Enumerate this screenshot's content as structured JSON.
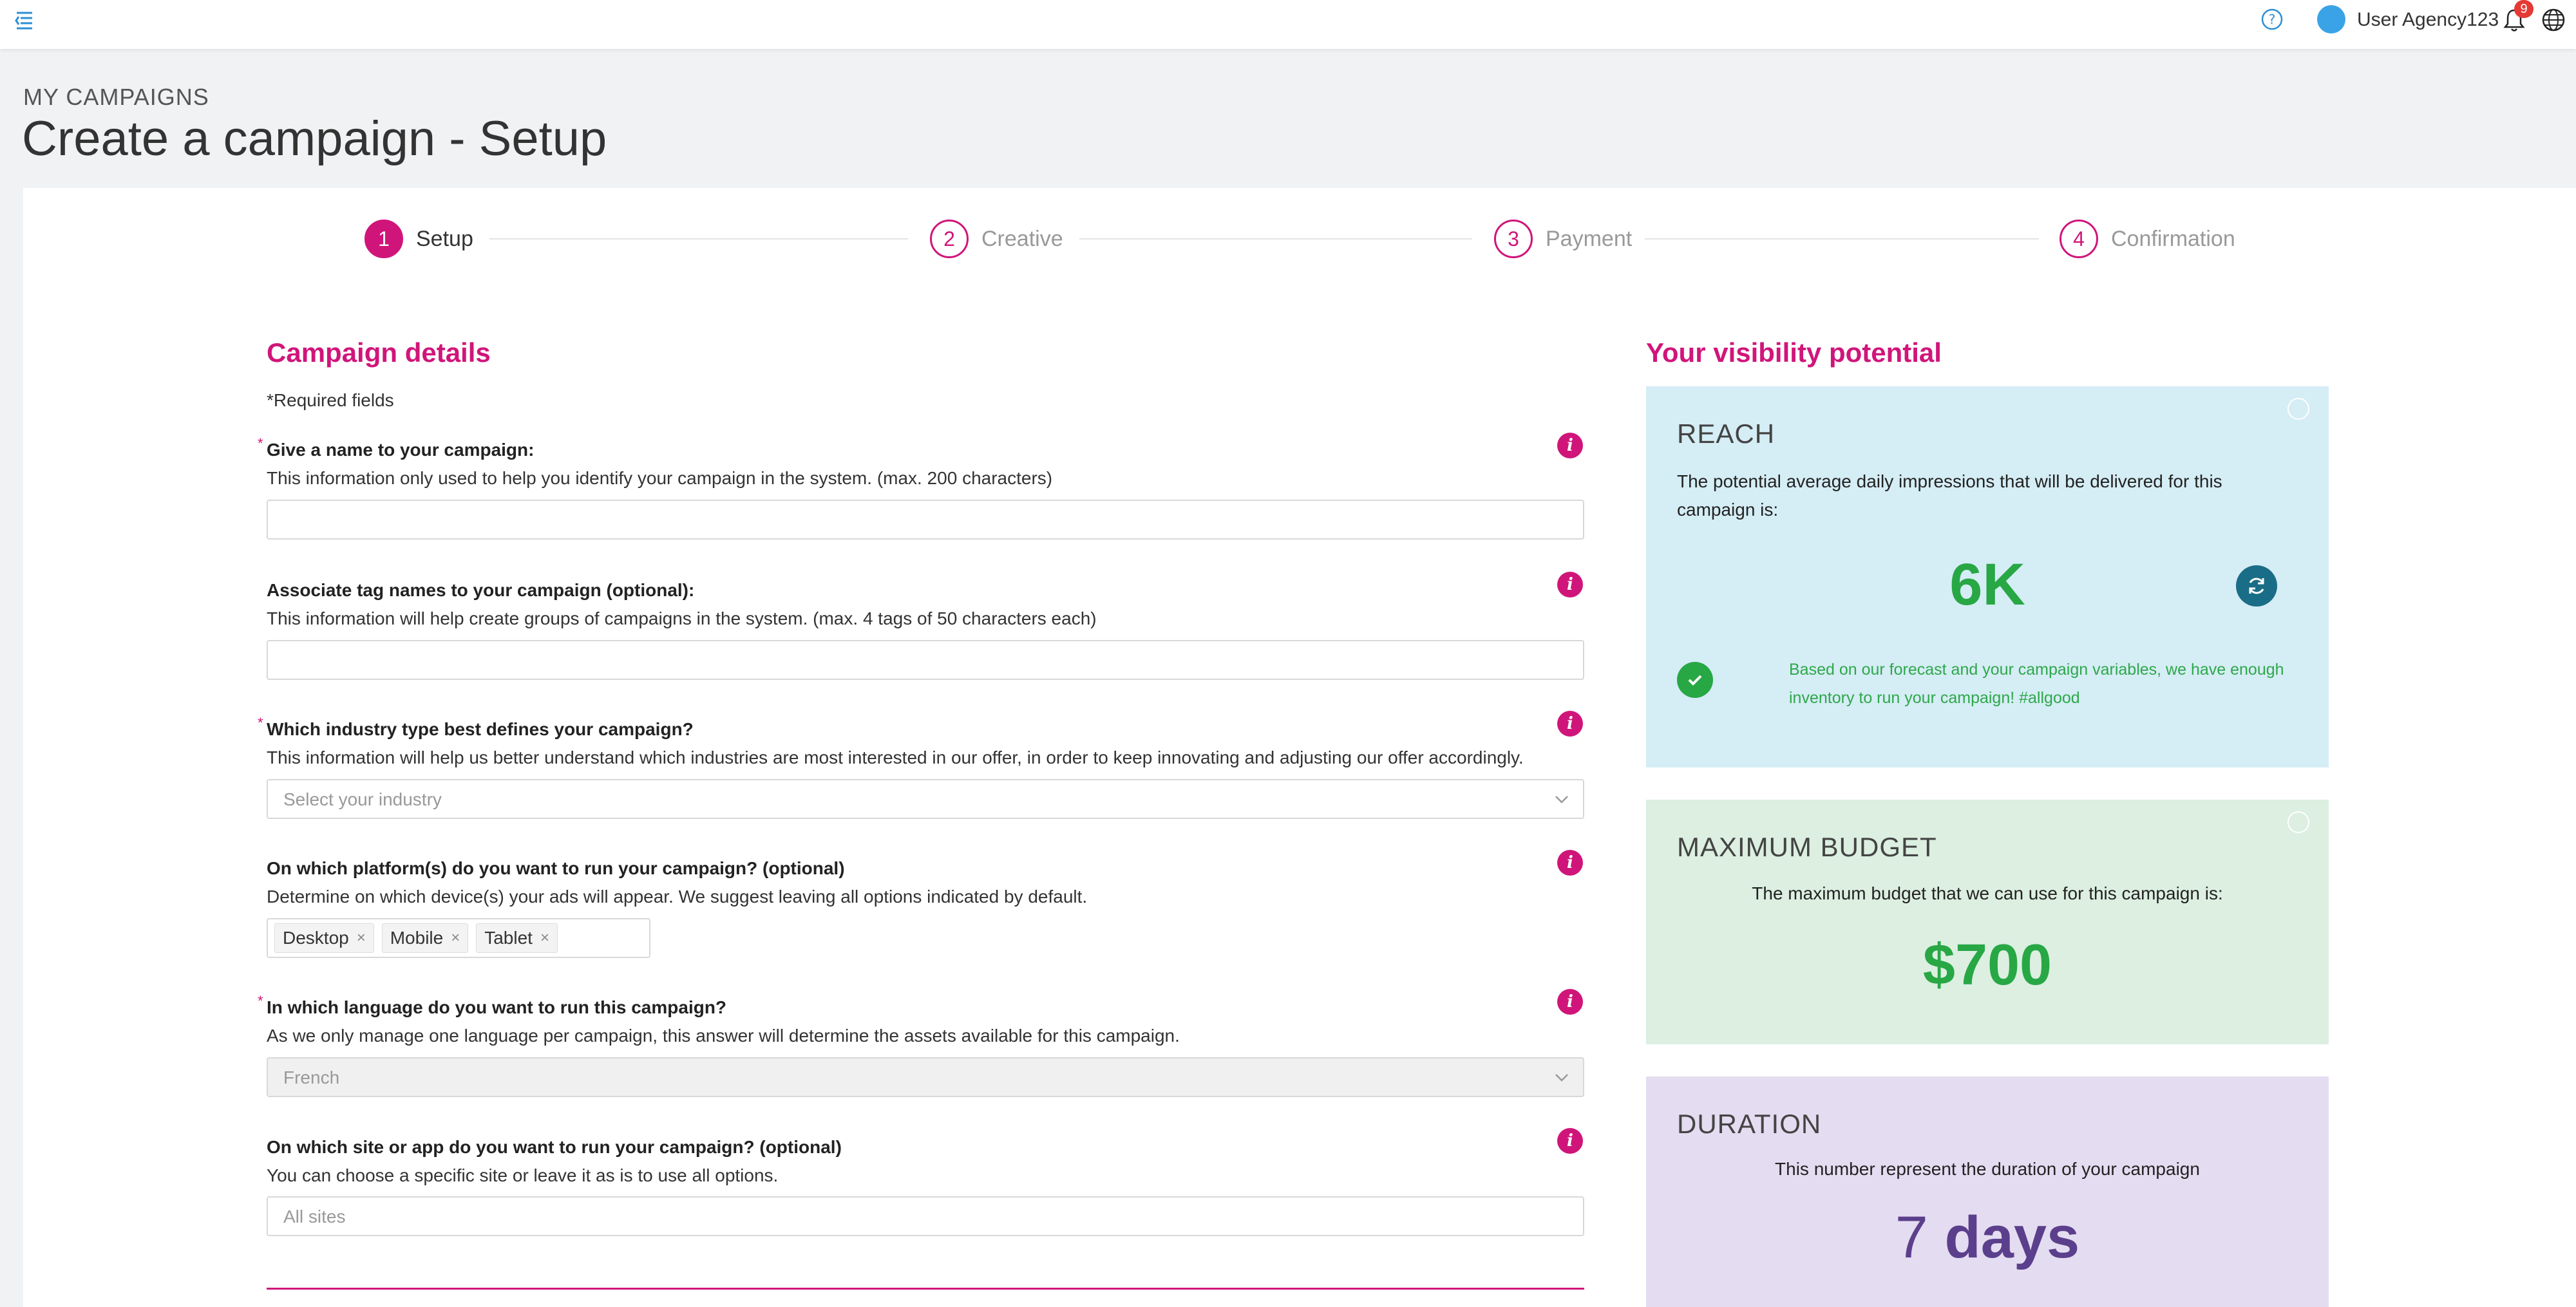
{
  "header": {
    "user_name": "User Agency123",
    "notification_count": "9"
  },
  "page": {
    "breadcrumb": "MY CAMPAIGNS",
    "title": "Create a campaign - Setup"
  },
  "steps": [
    {
      "number": "1",
      "label": "Setup",
      "active": true
    },
    {
      "number": "2",
      "label": "Creative",
      "active": false
    },
    {
      "number": "3",
      "label": "Payment",
      "active": false
    },
    {
      "number": "4",
      "label": "Confirmation",
      "active": false
    }
  ],
  "form": {
    "title": "Campaign details",
    "required_note": "*Required fields",
    "questions": [
      {
        "label": "Give a name to your campaign:",
        "desc": "This information only used to help you identify your campaign in the system. (max. 200 characters)",
        "required": true
      },
      {
        "label": "Associate tag names to your campaign (optional):",
        "desc": "This information will help create groups of campaigns in the system. (max. 4 tags of 50 characters each)",
        "required": false
      },
      {
        "label": "Which industry type best defines your campaign?",
        "desc": "This information will help us better understand which industries are most interested in our offer, in order to keep innovating and adjusting our offer accordingly.",
        "required": true,
        "placeholder": "Select your industry"
      },
      {
        "label": "On which platform(s) do you want to run your campaign? (optional)",
        "desc": "Determine on which device(s) your ads will appear. We suggest leaving all options indicated by default.",
        "required": false,
        "tags": [
          "Desktop",
          "Mobile",
          "Tablet"
        ]
      },
      {
        "label": "In which language do you want to run this campaign?",
        "desc": "As we only manage one language per campaign, this answer will determine the assets available for this campaign.",
        "required": true,
        "value": "French"
      },
      {
        "label": "On which site or app do you want to run your campaign? (optional)",
        "desc": "You can choose a specific site or leave it as is to use all options.",
        "required": false,
        "placeholder": "All sites"
      }
    ]
  },
  "visibility": {
    "title": "Your visibility potential",
    "reach": {
      "title": "REACH",
      "desc": "The potential average daily impressions that will be delivered for this campaign is:",
      "value": "6K",
      "note": "Based on our forecast and your campaign variables, we have enough inventory to run your campaign! #allgood"
    },
    "budget": {
      "title": "MAXIMUM BUDGET",
      "desc": "The maximum budget that we can use for this campaign is:",
      "value": "$700"
    },
    "duration": {
      "title": "DURATION",
      "desc": "This number represent the duration of your campaign",
      "value": "7",
      "unit": "days"
    }
  },
  "colors": {
    "accent": "#d0157a",
    "success": "#28a745",
    "reach_bg": "#d5edf5",
    "budget_bg": "#dcefe1",
    "duration_bg": "#e4dcf1"
  }
}
